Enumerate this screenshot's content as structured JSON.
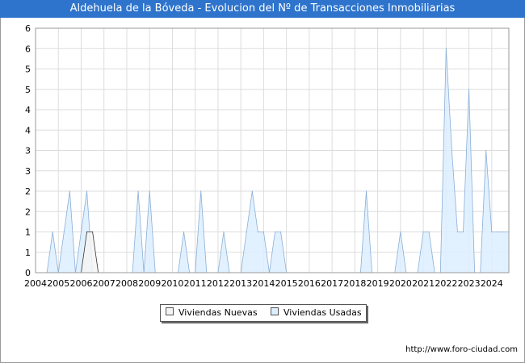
{
  "title": "Aldehuela de la Bóveda - Evolucion del Nº de Transacciones Inmobiliarias",
  "footer": "http://www.foro-ciudad.com",
  "colors": {
    "title_bg": "#2e74cc",
    "nuevas_fill": "#f4f4f4",
    "usadas_fill": "#ddeeff",
    "usadas_line": "#8aaed6",
    "nuevas_line": "#333333",
    "grid": "#dddddd"
  },
  "chart_data": {
    "type": "area",
    "title": "Aldehuela de la Bóveda - Evolucion del Nº de Transacciones Inmobiliarias",
    "xlabel": "",
    "ylabel": "",
    "xlim": [
      2004,
      2024.75
    ],
    "ylim": [
      0,
      6
    ],
    "y_ticks": [
      {
        "value": 0,
        "label": "0"
      },
      {
        "value": 0.5,
        "label": "1"
      },
      {
        "value": 1,
        "label": "1"
      },
      {
        "value": 1.5,
        "label": "2"
      },
      {
        "value": 2,
        "label": "2"
      },
      {
        "value": 2.5,
        "label": "3"
      },
      {
        "value": 3,
        "label": "3"
      },
      {
        "value": 3.5,
        "label": "4"
      },
      {
        "value": 4,
        "label": "4"
      },
      {
        "value": 4.5,
        "label": "5"
      },
      {
        "value": 5,
        "label": "5"
      },
      {
        "value": 5.5,
        "label": "6"
      },
      {
        "value": 6,
        "label": "6"
      }
    ],
    "x_ticks": [
      "2004",
      "2005",
      "2006",
      "2007",
      "2008",
      "2009",
      "2010",
      "2011",
      "2012",
      "2013",
      "2014",
      "2015",
      "2016",
      "2017",
      "2018",
      "2019",
      "2020",
      "2021",
      "2022",
      "2023",
      "2024"
    ],
    "grid": true,
    "legend_position": "bottom",
    "series": [
      {
        "name": "Viviendas Nuevas",
        "x": [
          2004.0,
          2004.25,
          2004.5,
          2004.75,
          2005.0,
          2005.25,
          2005.5,
          2005.75,
          2006.0,
          2006.25,
          2006.5,
          2006.75,
          2007.0
        ],
        "values": [
          0,
          0,
          0,
          0,
          0,
          0,
          0,
          0,
          0,
          1,
          1,
          0,
          0
        ]
      },
      {
        "name": "Viviendas Usadas",
        "x": [
          2004.0,
          2004.25,
          2004.5,
          2004.75,
          2005.0,
          2005.25,
          2005.5,
          2005.75,
          2006.0,
          2006.25,
          2006.5,
          2006.75,
          2007.0,
          2007.25,
          2007.5,
          2007.75,
          2008.0,
          2008.25,
          2008.5,
          2008.75,
          2009.0,
          2009.25,
          2009.5,
          2009.75,
          2010.0,
          2010.25,
          2010.5,
          2010.75,
          2011.0,
          2011.25,
          2011.5,
          2011.75,
          2012.0,
          2012.25,
          2012.5,
          2012.75,
          2013.0,
          2013.25,
          2013.5,
          2013.75,
          2014.0,
          2014.25,
          2014.5,
          2014.75,
          2015.0,
          2015.25,
          2015.5,
          2015.75,
          2016.0,
          2016.25,
          2016.5,
          2016.75,
          2017.0,
          2017.25,
          2017.5,
          2017.75,
          2018.0,
          2018.25,
          2018.5,
          2018.75,
          2019.0,
          2019.25,
          2019.5,
          2019.75,
          2020.0,
          2020.25,
          2020.5,
          2020.75,
          2021.0,
          2021.25,
          2021.5,
          2021.75,
          2022.0,
          2022.25,
          2022.5,
          2022.75,
          2023.0,
          2023.25,
          2023.5,
          2023.75,
          2024.0,
          2024.25,
          2024.5,
          2024.75
        ],
        "values": [
          0,
          0,
          0,
          1,
          0,
          1,
          2,
          0,
          1,
          2,
          0,
          0,
          0,
          0,
          0,
          0,
          0,
          0,
          2,
          0,
          2,
          0,
          0,
          0,
          0,
          0,
          1,
          0,
          0,
          2,
          0,
          0,
          0,
          1,
          0,
          0,
          0,
          1,
          2,
          1,
          1,
          0,
          1,
          1,
          0,
          0,
          0,
          0,
          0,
          0,
          0,
          0,
          0,
          0,
          0,
          0,
          0,
          0,
          2,
          0,
          0,
          0,
          0,
          0,
          1,
          0,
          0,
          0,
          1,
          1,
          0,
          0,
          5.5,
          3,
          1,
          1,
          4.5,
          0,
          0,
          3,
          1,
          1,
          1,
          1
        ]
      }
    ]
  }
}
